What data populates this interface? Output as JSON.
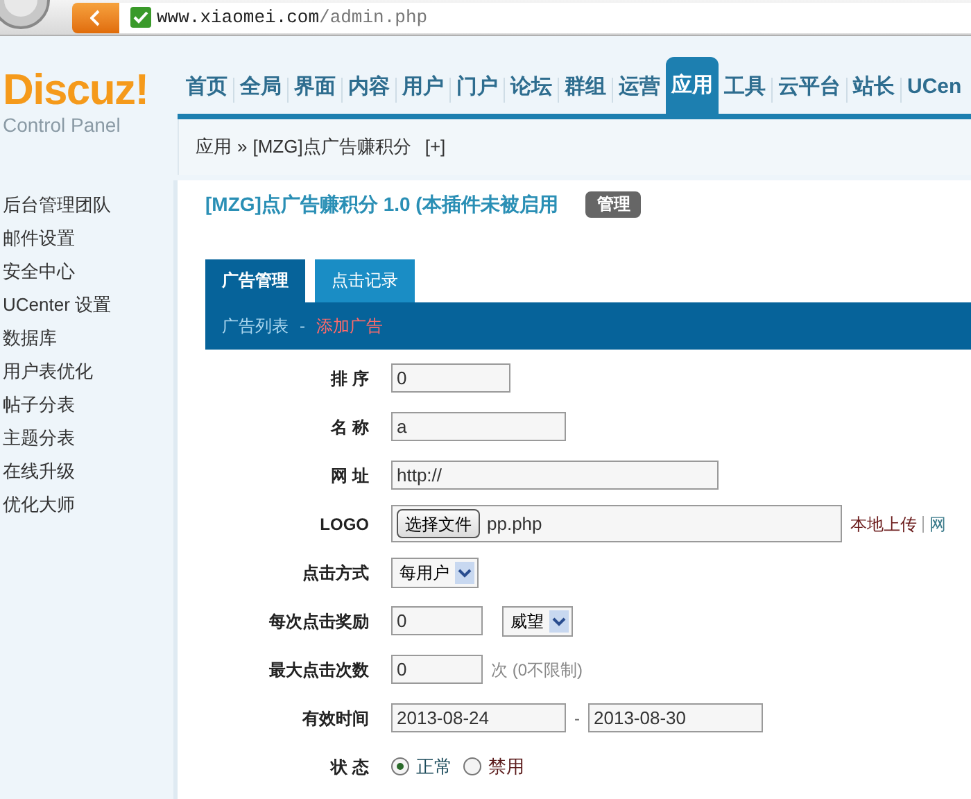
{
  "browser": {
    "url_host": "www.xiaomei.com",
    "url_path": "/admin.php"
  },
  "logo": {
    "title": "Discuz!",
    "subtitle": "Control Panel"
  },
  "nav": [
    {
      "label": "首页",
      "selected": false
    },
    {
      "label": "全局",
      "selected": false
    },
    {
      "label": "界面",
      "selected": false
    },
    {
      "label": "内容",
      "selected": false
    },
    {
      "label": "用户",
      "selected": false
    },
    {
      "label": "门户",
      "selected": false
    },
    {
      "label": "论坛",
      "selected": false
    },
    {
      "label": "群组",
      "selected": false
    },
    {
      "label": "运营",
      "selected": false
    },
    {
      "label": "应用",
      "selected": true
    },
    {
      "label": "工具",
      "selected": false
    },
    {
      "label": "云平台",
      "selected": false
    },
    {
      "label": "站长",
      "selected": false
    },
    {
      "label": "UCen",
      "selected": false
    }
  ],
  "breadcrumb": {
    "root": "应用",
    "separator": "»",
    "current": "[MZG]点广告赚积分",
    "add": "[+]"
  },
  "sidebar": {
    "items": [
      "后台管理团队",
      "邮件设置",
      "安全中心",
      "UCenter 设置",
      "数据库",
      "用户表优化",
      "帖子分表",
      "主题分表",
      "在线升级",
      "优化大师"
    ]
  },
  "page_title": "[MZG]点广告赚积分 1.0 (本插件未被启用",
  "manage_badge": "管理",
  "tabs": [
    {
      "label": "广告管理",
      "selected": true
    },
    {
      "label": "点击记录",
      "selected": false
    }
  ],
  "subnav": [
    {
      "label": "广告列表",
      "selected": false
    },
    {
      "label": "添加广告",
      "selected": true
    }
  ],
  "subnav_separator": "-",
  "form": [
    {
      "kind": "text",
      "label": "排 序",
      "value": "0"
    },
    {
      "kind": "text",
      "label": "名 称",
      "value": "a"
    },
    {
      "kind": "text",
      "label": "网 址",
      "value": "http://"
    },
    {
      "kind": "file",
      "label": "LOGO",
      "button": "选择文件",
      "file": "pp.php",
      "links": [
        "本地上传",
        "网"
      ]
    },
    {
      "kind": "select",
      "label": "点击方式",
      "value": "每用户"
    },
    {
      "kind": "reward",
      "label": "每次点击奖励",
      "value": "0",
      "select": "威望"
    },
    {
      "kind": "count",
      "label": "最大点击次数",
      "value": "0",
      "hint": "次 (0不限制)"
    },
    {
      "kind": "daterange",
      "label": "有效时间",
      "from": "2013-08-24",
      "separator": "-",
      "to": "2013-08-30"
    },
    {
      "kind": "radio",
      "label": "状 态",
      "options": [
        {
          "label": "正常",
          "selected": true
        },
        {
          "label": "禁用",
          "selected": false
        }
      ]
    }
  ]
}
